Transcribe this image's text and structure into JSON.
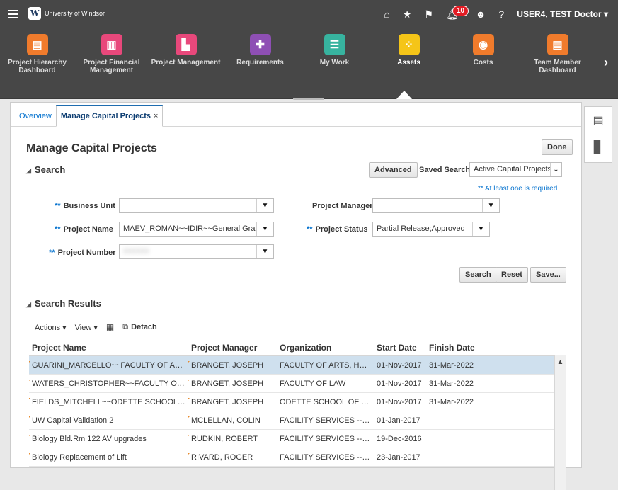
{
  "header": {
    "brand": "University of Windsor",
    "notification_count": "10",
    "user": "USER4, TEST Doctor"
  },
  "springboard": [
    {
      "label": "Project Hierarchy Dashboard",
      "color": "#f07b2c",
      "glyph": "▤"
    },
    {
      "label": "Project Financial Management",
      "color": "#e8487b",
      "glyph": "▥"
    },
    {
      "label": "Project Management",
      "color": "#e8487b",
      "glyph": "▙"
    },
    {
      "label": "Requirements",
      "color": "#8e4fb4",
      "glyph": "✚"
    },
    {
      "label": "My Work",
      "color": "#37b39f",
      "glyph": "☰"
    },
    {
      "label": "Assets",
      "color": "#f5c518",
      "glyph": "⁘"
    },
    {
      "label": "Costs",
      "color": "#f07b2c",
      "glyph": "◉"
    },
    {
      "label": "Team Member Dashboard",
      "color": "#f07b2c",
      "glyph": "▤"
    }
  ],
  "tabs": {
    "overview": "Overview",
    "active": "Manage Capital Projects"
  },
  "page": {
    "title": "Manage Capital Projects",
    "done": "Done",
    "search_heading": "Search",
    "advanced": "Advanced",
    "saved_search_label": "Saved Search",
    "saved_search_value": "Active Capital Projects",
    "required_note": "** At least one is required",
    "business_unit_label": "Business Unit",
    "business_unit_value": "",
    "project_name_label": "Project Name",
    "project_name_value": "MAEV_ROMAN~~IDIR~~General Grant~",
    "project_number_label": "Project Number",
    "project_number_value": "000000",
    "project_manager_label": "Project Manager",
    "project_manager_value": "",
    "project_status_label": "Project Status",
    "project_status_value": "Partial Release;Approved",
    "search_btn": "Search",
    "reset_btn": "Reset",
    "save_btn": "Save...",
    "results_heading": "Search Results",
    "actions": "Actions ▾",
    "view": "View ▾",
    "detach": "Detach"
  },
  "grid": {
    "columns": [
      "Project Name",
      "Project Manager",
      "Organization",
      "Start Date",
      "Finish Date"
    ],
    "rows": [
      [
        "GUARINI_MARCELLO~~FACULTY OF ART...",
        "BRANGET, JOSEPH",
        "FACULTY OF ARTS, HUM...",
        "01-Nov-2017",
        "31-Mar-2022"
      ],
      [
        "WATERS_CHRISTOPHER~~FACULTY OF ...",
        "BRANGET, JOSEPH",
        "FACULTY OF LAW",
        "01-Nov-2017",
        "31-Mar-2022"
      ],
      [
        "FIELDS_MITCHELL~~ODETTE SCHOOL ...",
        "BRANGET, JOSEPH",
        "ODETTE SCHOOL OF B...",
        "01-Nov-2017",
        "31-Mar-2022"
      ],
      [
        "UW Capital Validation 2",
        "MCLELLAN, COLIN",
        "FACILITY SERVICES -- P...",
        "01-Jan-2017",
        ""
      ],
      [
        "Biology Bld.Rm 122 AV upgrades",
        "RUDKIN, ROBERT",
        "FACILITY SERVICES -- M...",
        "19-Dec-2016",
        ""
      ],
      [
        "Biology Replacement of Lift",
        "RIVARD, ROGER",
        "FACILITY SERVICES -- M...",
        "23-Jan-2017",
        ""
      ]
    ]
  }
}
